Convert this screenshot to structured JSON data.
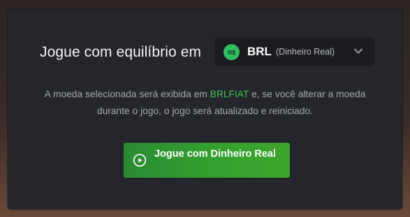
{
  "dialog": {
    "heading": "Jogue com equilíbrio em",
    "currency": {
      "icon_text": "R$",
      "code": "BRL",
      "name": "(Dinheiro Real)",
      "icon": "chevron-down-icon"
    },
    "info": {
      "part1": "A moeda selecionada será exibida em ",
      "highlight": "BRLFIAT",
      "part2": " e, se você alterar a moeda durante o jogo, o jogo será atualizado e reiniciado."
    },
    "play_button": {
      "label": "Jogue com Dinheiro Real",
      "icon": "play-circle-icon"
    }
  },
  "colors": {
    "accent_green": "#44c45a",
    "button_green": "#34a02e",
    "coin_green": "#2fbf5e",
    "panel_bg": "#24262b"
  }
}
